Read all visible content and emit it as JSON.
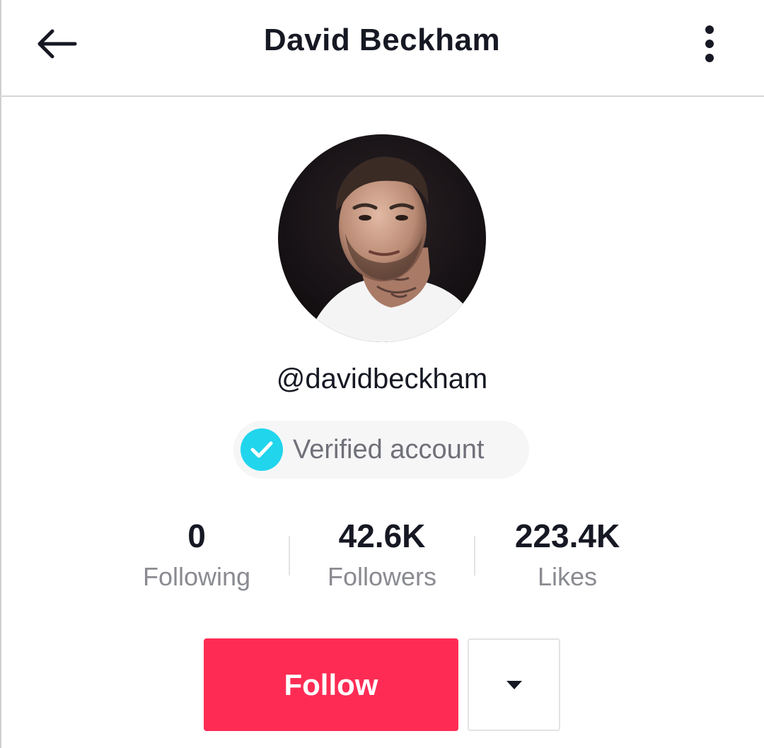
{
  "header": {
    "title": "David Beckham",
    "back_icon": "arrow-left-icon",
    "more_icon": "vertical-dots-icon"
  },
  "profile": {
    "avatar": "profile-photo",
    "handle": "@davidbeckham",
    "verified_label": "Verified account",
    "verified_color": "#20d5ec"
  },
  "stats": [
    {
      "value": "0",
      "label": "Following"
    },
    {
      "value": "42.6K",
      "label": "Followers"
    },
    {
      "value": "223.4K",
      "label": "Likes"
    }
  ],
  "actions": {
    "follow_label": "Follow",
    "follow_color": "#fe2c55",
    "dropdown_icon": "caret-down-icon"
  }
}
